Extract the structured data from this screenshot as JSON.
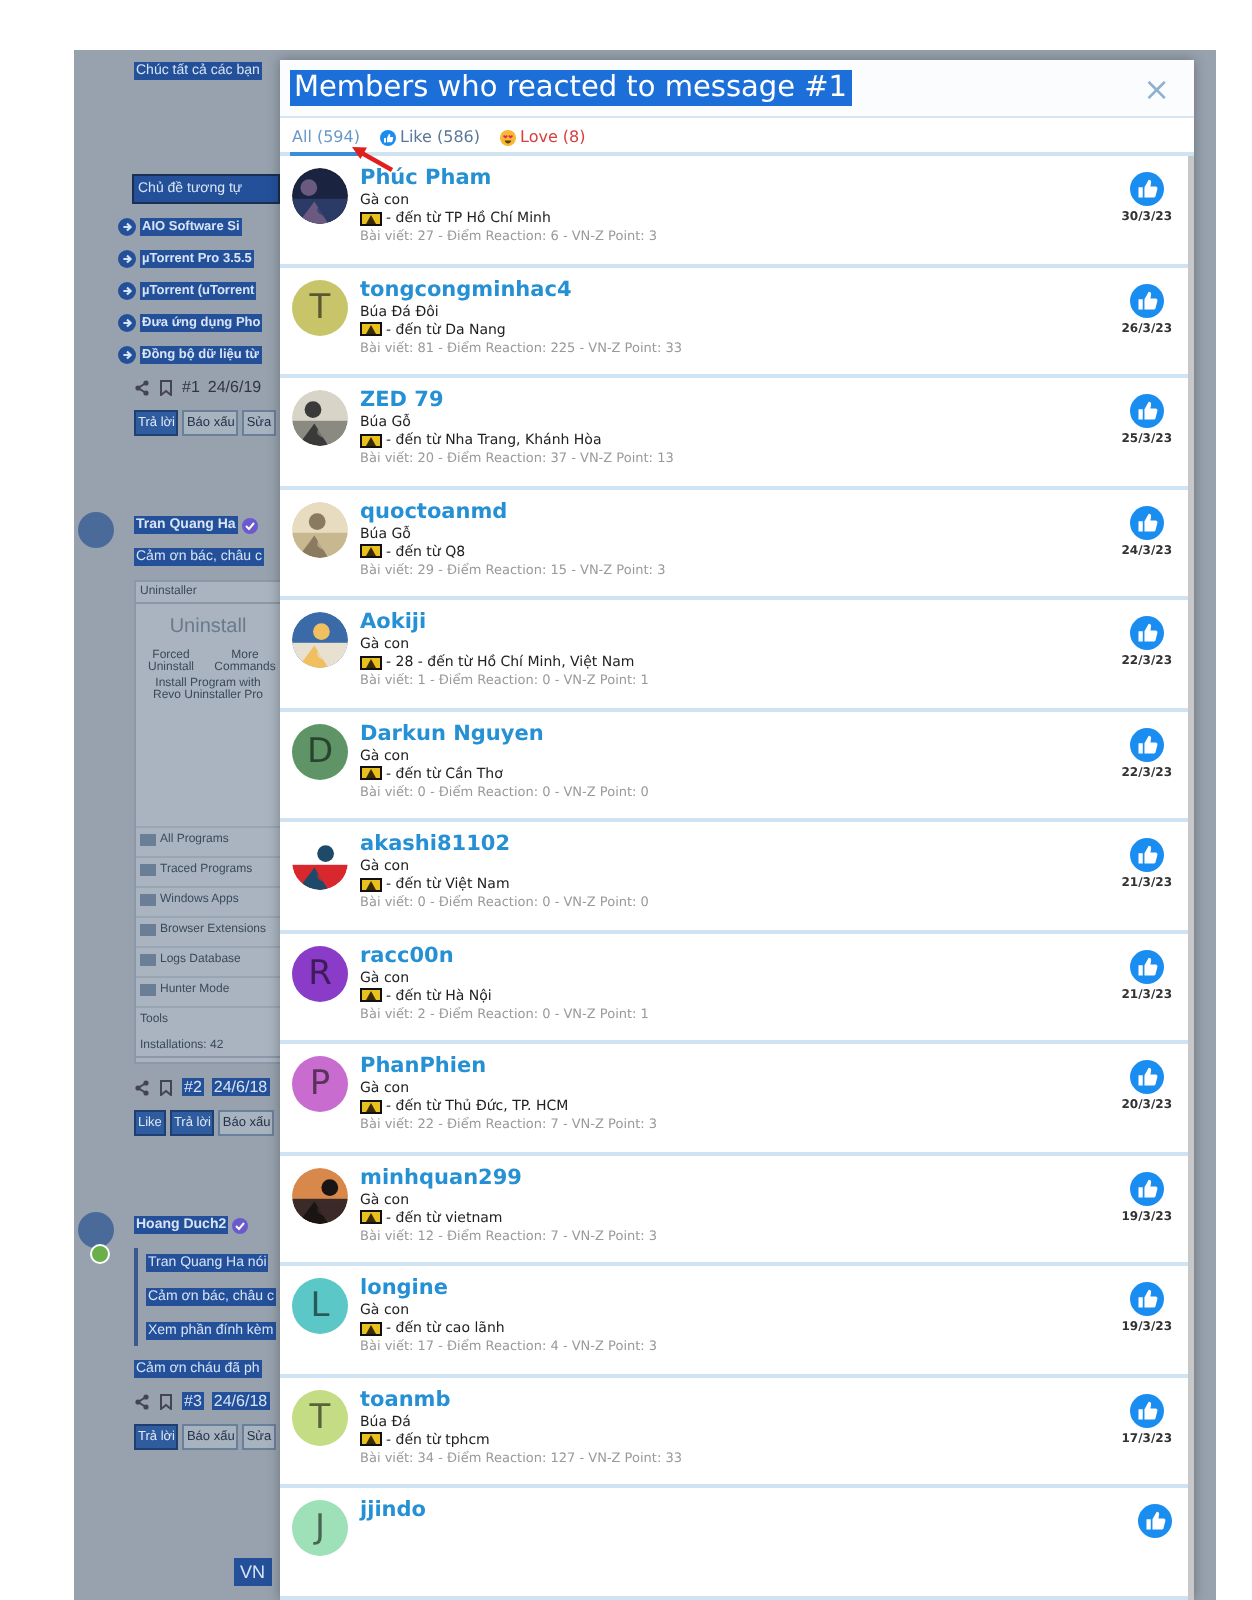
{
  "background_page": {
    "blocks": [
      {
        "kind": "highlight",
        "text": "Chúc tất cả các bạn"
      },
      {
        "kind": "heading",
        "text": "Chủ đề tương tự"
      },
      {
        "kind": "thread_link",
        "text": "AIO Software Si"
      },
      {
        "kind": "thread_link",
        "text": "µTorrent Pro 3.5.5"
      },
      {
        "kind": "thread_link",
        "text": "µTorrent (uTorrent"
      },
      {
        "kind": "thread_link",
        "text": "Đưa ứng dụng Pho"
      },
      {
        "kind": "thread_link",
        "text": "Đồng bộ dữ liệu từ"
      },
      {
        "kind": "meta",
        "number": "#1",
        "date": "24/6/19",
        "highlighted": false
      },
      {
        "kind": "actions",
        "buttons": [
          {
            "label": "Trả lời",
            "primary": true
          },
          {
            "label": "Báo xấu",
            "primary": false
          },
          {
            "label": "Sửa",
            "primary": false
          }
        ]
      },
      {
        "kind": "author",
        "name": "Tran Quang Ha",
        "online": false
      },
      {
        "kind": "highlight",
        "text": "Cảm ơn bác, châu c"
      },
      {
        "kind": "screenshot",
        "title": "Uninstaller",
        "big": "Uninstall",
        "commands": [
          "Forced Uninstall",
          "More Commands"
        ],
        "install": "Install Program with Revo Uninstaller Pro",
        "items": [
          "All Programs",
          "Traced Programs",
          "Windows Apps",
          "Browser Extensions",
          "Logs Database",
          "Hunter Mode"
        ],
        "tools": "Tools",
        "footer": "Installations: 42"
      },
      {
        "kind": "meta",
        "number": "#2",
        "date": "24/6/18",
        "highlighted": true
      },
      {
        "kind": "actions",
        "buttons": [
          {
            "label": "Like",
            "primary": true
          },
          {
            "label": "Trả lời",
            "primary": true
          },
          {
            "label": "Báo xấu",
            "primary": false
          }
        ]
      },
      {
        "kind": "author",
        "name": "Hoang Duch2",
        "online": true
      },
      {
        "kind": "quote",
        "lines": [
          "Tran Quang Ha nói",
          "Cảm ơn bác, châu c",
          "Xem phần đính kèm"
        ]
      },
      {
        "kind": "highlight",
        "text": "Cảm ơn cháu đã ph"
      },
      {
        "kind": "meta",
        "number": "#3",
        "date": "24/6/18",
        "highlighted": true
      },
      {
        "kind": "actions",
        "buttons": [
          {
            "label": "Trả lời",
            "primary": true
          },
          {
            "label": "Báo xấu",
            "primary": false
          },
          {
            "label": "Sửa",
            "primary": false
          }
        ]
      },
      {
        "kind": "footer",
        "text": "VN"
      }
    ]
  },
  "modal": {
    "title": "Members who reacted to message #1",
    "close": "×",
    "tabs": [
      {
        "label": "All (594)",
        "kind": "all",
        "selected": true
      },
      {
        "label": "Like (586)",
        "kind": "like",
        "selected": false
      },
      {
        "label": "Love (8)",
        "kind": "love",
        "selected": false
      }
    ],
    "members": [
      {
        "name": "Phúc Pham",
        "title": "Gà con",
        "location": "- đến từ TP Hồ Chí Minh",
        "stats": "Bài viết: 27 - Điểm Reaction: 6 - VN-Z Point: 3",
        "date": "30/3/23"
      },
      {
        "name": "tongcongminhac4",
        "avatar": {
          "kind": "letter",
          "letter": "T",
          "color": "#c8c46a"
        },
        "title": "Búa Đá Đôi",
        "location": "- đến từ Da Nang",
        "stats": "Bài viết: 81 - Điểm Reaction: 225 - VN-Z Point: 33",
        "date": "26/3/23"
      },
      {
        "name": "ZED 79",
        "title": "Búa Gỗ",
        "location": "- đến từ Nha Trang, Khánh Hòa",
        "stats": "Bài viết: 20 - Điểm Reaction: 37 - VN-Z Point: 13",
        "date": "25/3/23"
      },
      {
        "name": "quoctoanmd",
        "title": "Búa Gỗ",
        "location": "- đến từ Q8",
        "stats": "Bài viết: 29 - Điểm Reaction: 15 - VN-Z Point: 3",
        "date": "24/3/23"
      },
      {
        "name": "Aokiji",
        "title": "Gà con",
        "location": "- 28 - đến từ Hồ Chí Minh, Việt Nam",
        "stats": "Bài viết: 1 - Điểm Reaction: 0 - VN-Z Point: 1",
        "date": "22/3/23"
      },
      {
        "name": "Darkun Nguyen",
        "avatar": {
          "kind": "letter",
          "letter": "D",
          "color": "#5e9466"
        },
        "title": "Gà con",
        "location": "- đến từ Cần Thơ",
        "stats": "Bài viết: 0 - Điểm Reaction: 0 - VN-Z Point: 0",
        "date": "22/3/23"
      },
      {
        "name": "akashi81102",
        "title": "Gà con",
        "location": "- đến từ Việt Nam",
        "stats": "Bài viết: 0 - Điểm Reaction: 0 - VN-Z Point: 0",
        "date": "21/3/23"
      },
      {
        "name": "racc00n",
        "avatar": {
          "kind": "letter",
          "letter": "R",
          "color": "#8a3cc8"
        },
        "title": "Gà con",
        "location": "- đến từ Hà Nội",
        "stats": "Bài viết: 2 - Điểm Reaction: 0 - VN-Z Point: 1",
        "date": "21/3/23"
      },
      {
        "name": "PhanPhien",
        "avatar": {
          "kind": "letter",
          "letter": "P",
          "color": "#c86ccf"
        },
        "title": "Gà con",
        "location": "- đến từ Thủ Đức, TP. HCM",
        "stats": "Bài viết: 22 - Điểm Reaction: 7 - VN-Z Point: 3",
        "date": "20/3/23"
      },
      {
        "name": "minhquan299",
        "title": "Gà con",
        "location": "- đến từ vietnam",
        "stats": "Bài viết: 12 - Điểm Reaction: 7 - VN-Z Point: 3",
        "date": "19/3/23"
      },
      {
        "name": "longine",
        "avatar": {
          "kind": "letter",
          "letter": "L",
          "color": "#5cc7c7"
        },
        "title": "Gà con",
        "location": "- đến từ cao lãnh",
        "stats": "Bài viết: 17 - Điểm Reaction: 4 - VN-Z Point: 3",
        "date": "19/3/23"
      },
      {
        "name": "toanmb",
        "avatar": {
          "kind": "letter",
          "letter": "T",
          "color": "#c4dc84"
        },
        "title": "Búa Đá",
        "location": "- đến từ tphcm",
        "stats": "Bài viết: 34 - Điểm Reaction: 127 - VN-Z Point: 33",
        "date": "17/3/23"
      },
      {
        "name": "jjindo",
        "avatar": {
          "kind": "letter",
          "letter": "J",
          "color": "#9ee0b8"
        }
      }
    ]
  }
}
